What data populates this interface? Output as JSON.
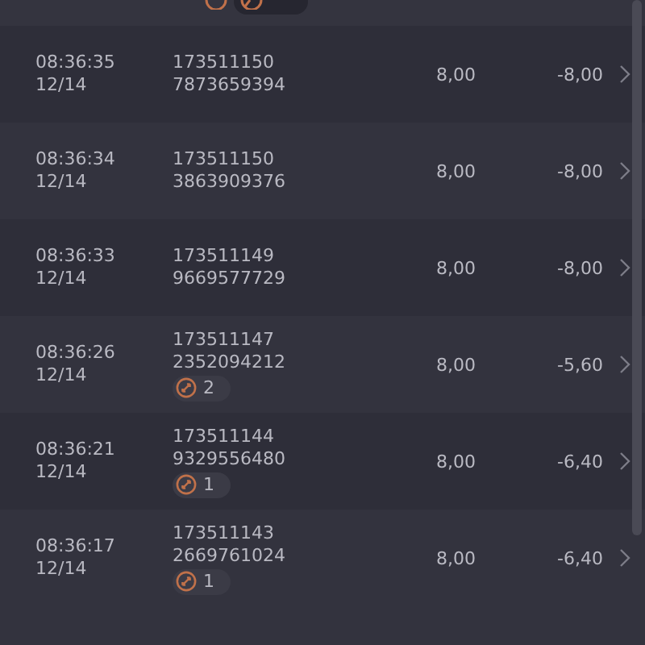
{
  "rows": [
    {
      "time": "08:36:35",
      "date": "12/14",
      "id_lines": [
        "173511150",
        "7873659394"
      ],
      "amount": "8,00",
      "total": "-8,00"
    },
    {
      "time": "08:36:34",
      "date": "12/14",
      "id_lines": [
        "173511150",
        "3863909376"
      ],
      "amount": "8,00",
      "total": "-8,00"
    },
    {
      "time": "08:36:33",
      "date": "12/14",
      "id_lines": [
        "173511149",
        "9669577729"
      ],
      "amount": "8,00",
      "total": "-8,00"
    },
    {
      "time": "08:36:26",
      "date": "12/14",
      "id_lines": [
        "173511147",
        "2352094212"
      ],
      "badge": "2",
      "amount": "8,00",
      "total": "-5,60"
    },
    {
      "time": "08:36:21",
      "date": "12/14",
      "id_lines": [
        "173511144",
        "9329556480"
      ],
      "badge": "1",
      "amount": "8,00",
      "total": "-6,40"
    },
    {
      "time": "08:36:17",
      "date": "12/14",
      "id_lines": [
        "173511143",
        "2669761024"
      ],
      "badge": "1",
      "amount": "8,00",
      "total": "-6,40"
    }
  ]
}
